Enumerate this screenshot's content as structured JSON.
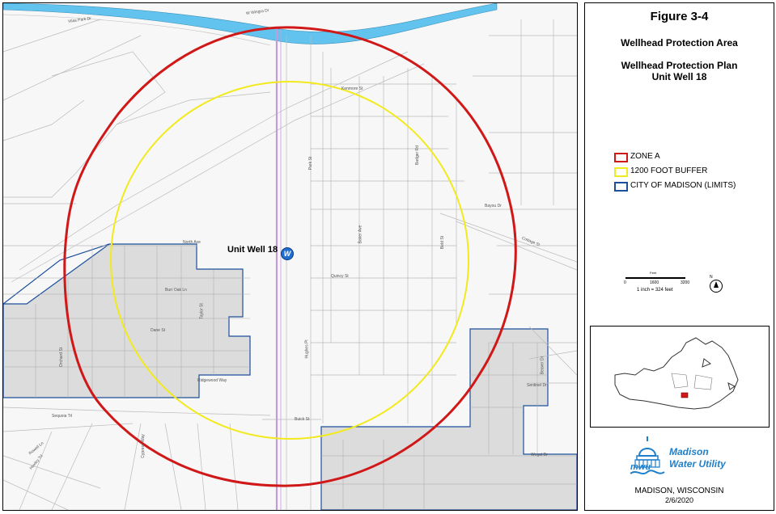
{
  "figure": {
    "number": "Figure 3-4",
    "title": "Wellhead Protection Area",
    "plan_title": "Wellhead Protection Plan",
    "plan_subtitle": "Unit Well 18"
  },
  "legend": {
    "items": [
      {
        "label": "ZONE A",
        "color": "#d01818"
      },
      {
        "label": "1200 FOOT BUFFER",
        "color": "#f2ea1c"
      },
      {
        "label": "CITY OF MADISON (LIMITS)",
        "color": "#1d4f9c"
      }
    ]
  },
  "scale": {
    "ticks": [
      "0",
      "1600",
      "3200"
    ],
    "unit_label": "Feet",
    "ratio": "1 inch = 324 feet"
  },
  "north_arrow_label": "N",
  "well": {
    "label": "Unit Well 18",
    "symbol": "W"
  },
  "map_labels": {
    "top_street": "W Wingra Dr",
    "top_left_street": "Vilas Park Dr",
    "kenmore": "Kenmore St",
    "north_ave": "North Ave",
    "burr_oak": "Burr Oak Ln",
    "taylor": "Taylor St",
    "dane": "Dane St",
    "orchard": "Orchard St",
    "ridgewood": "Ridgewood Way",
    "sequoia": "Sequoia Trl",
    "huxley": "Huxley Trl",
    "cypress": "Cypress Way",
    "baker": "Baker Ave",
    "quincy": "Quincy St",
    "badger": "Badger Rd",
    "beld": "Beld St",
    "park": "Park St",
    "hughes": "Hughes Pl",
    "buick": "Buick St",
    "sentinel": "Sentinel Dr",
    "beaver": "Beaver Dr",
    "wegal": "Wegal Dr",
    "cottage": "Cottage St",
    "rowell": "Rowell Ln",
    "bayou": "Bayou Dr"
  },
  "logo": {
    "line1": "Madison",
    "line2": "Water Utility",
    "initials": "mwu"
  },
  "footer": {
    "location": "MADISON, WISCONSIN",
    "date": "2/6/2020"
  },
  "colors": {
    "zone_a": "#d01818",
    "buffer": "#f2ea1c",
    "city_limits": "#1d4f9c",
    "river": "#62c4ee",
    "parcel_fill": "#dcdcdc",
    "street_line": "#bbbbbb",
    "railroad": "#c29cd9"
  }
}
